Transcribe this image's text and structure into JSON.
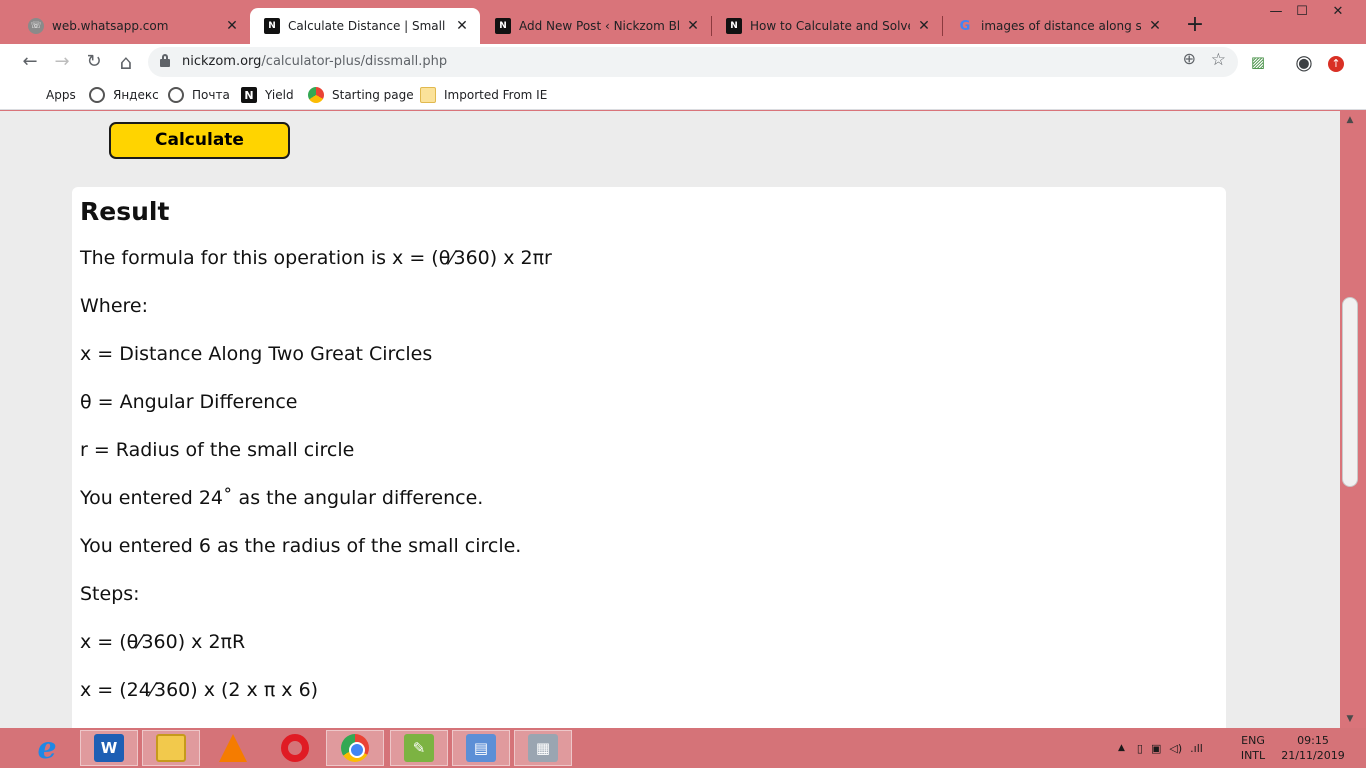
{
  "browser": {
    "tabs": [
      {
        "title": "web.whatsapp.com",
        "favicon": "whatsapp-icon",
        "active": false
      },
      {
        "title": "Calculate Distance | Small Circle",
        "favicon": "nickzom-icon",
        "active": true
      },
      {
        "title": "Add New Post ‹ Nickzom Blog —",
        "favicon": "nickzom-icon",
        "active": false
      },
      {
        "title": "How to Calculate and Solve for",
        "favicon": "nickzom-icon",
        "active": false
      },
      {
        "title": "images of distance along small",
        "favicon": "google-icon",
        "active": false
      }
    ],
    "close_glyph": "✕",
    "new_tab_glyph": "+",
    "window_controls": {
      "minimize": "—",
      "maximize": "☐",
      "close": "✕"
    },
    "address": {
      "host": "nickzom.org",
      "path": "/calculator-plus/dissmall.php"
    },
    "nav": {
      "back": "←",
      "forward": "→",
      "reload": "↻",
      "home": "⌂"
    },
    "bookmarks": [
      {
        "label": "Apps",
        "icon": "apps-grid-icon"
      },
      {
        "label": "Яндекс",
        "icon": "globe-icon"
      },
      {
        "label": "Почта",
        "icon": "globe-icon"
      },
      {
        "label": "Yield",
        "icon": "nickzom-icon"
      },
      {
        "label": "Starting page",
        "icon": "chrome-icon"
      },
      {
        "label": "Imported From IE",
        "icon": "folder-icon"
      }
    ]
  },
  "page": {
    "calculate_label": "Calculate",
    "result": {
      "heading": "Result",
      "lines": [
        "The formula for this operation is x = (θ⁄360) x 2πr",
        "Where:",
        "x = Distance Along Two Great Circles",
        "θ = Angular Difference",
        "r = Radius of the small circle",
        "You entered 24˚ as the angular difference.",
        "You entered 6 as the radius of the small circle.",
        "Steps:",
        "x = (θ⁄360) x 2πR",
        "x = (24⁄360) x (2 x π x 6)"
      ]
    }
  },
  "taskbar": {
    "apps": [
      "internet-explorer",
      "microsoft-word",
      "file-explorer",
      "vlc",
      "opera",
      "chrome",
      "notepad",
      "control-panel",
      "calculator"
    ],
    "language": {
      "line1": "ENG",
      "line2": "INTL"
    },
    "clock": {
      "time": "09:15",
      "date": "21/11/2019"
    }
  },
  "colors": {
    "frame": "#d9747a",
    "calculate_button": "#ffd400",
    "page_background": "#ececec",
    "card": "#ffffff"
  }
}
